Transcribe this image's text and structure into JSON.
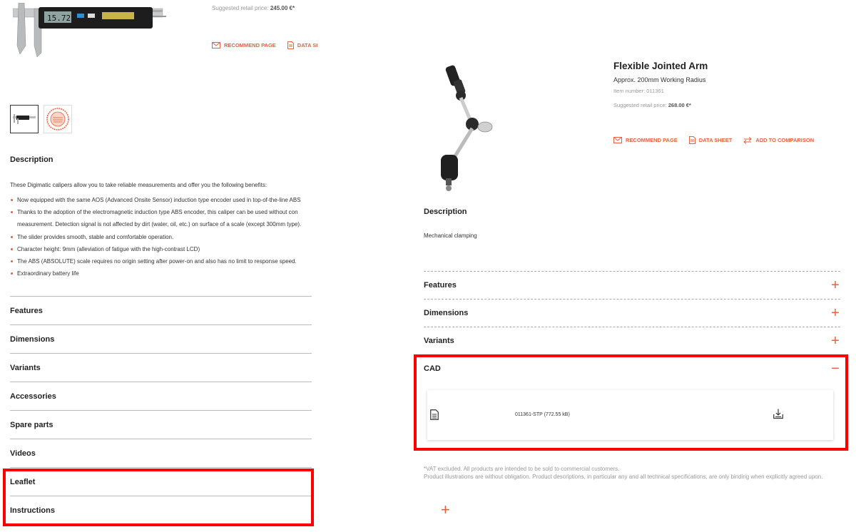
{
  "left": {
    "price_label": "Suggested retail price:",
    "price_value": "245.00 €*",
    "actions": {
      "recommend": "RECOMMEND PAGE",
      "datasheet": "DATA SI"
    },
    "caliper_display": "15.72",
    "description_title": "Description",
    "description_intro": "These Digimatic calipers allow you to take reliable measurements and offer you the following benefits:",
    "bullets": [
      "Now equipped with the same AOS (Advanced Onsite Sensor) induction type encoder used in top-of-the-line ABS",
      "Thanks to the adoption of the electromagnetic induction type ABS encoder, this caliper can be used without con",
      "measurement. Detection signal is not affected by dirt (water, oil, etc.) on surface of a scale (except 300mm type).",
      "The slider provides smooth, stable and comfortable operation.",
      "Character height: 9mm (alleviation of fatigue with the high-contrast LCD)",
      "The ABS (ABSOLUTE) scale requires no origin setting after power-on and also has no limit to response speed.",
      "Extraordinary battery life"
    ],
    "accordion": [
      "Features",
      "Dimensions",
      "Variants",
      "Accessories",
      "Spare parts",
      "Videos",
      "Leaflet",
      "Instructions"
    ]
  },
  "right": {
    "title": "Flexible Jointed Arm",
    "subtitle": "Approx. 200mm Working Radius",
    "item_number": "Item number: 011361",
    "price_label": "Suggested retail price:",
    "price_value": "268.00 €*",
    "actions": {
      "recommend": "RECOMMEND PAGE",
      "datasheet": "DATA SHEET",
      "compare": "ADD TO COMPARISON"
    },
    "description_title": "Description",
    "description_text": "Mechanical clamping",
    "accordion": [
      {
        "label": "Features",
        "toggle": "+"
      },
      {
        "label": "Dimensions",
        "toggle": "+"
      },
      {
        "label": "Variants",
        "toggle": "+"
      },
      {
        "label": "CAD",
        "toggle": "−"
      }
    ],
    "cad_file": "011361-STP (772.55 kB)",
    "vat_line1": "*VAT excluded. All products are intended to be sold to commercial customers.",
    "vat_line2": "Product illustrations are without obligation. Product descriptions, in particular any and all technical specifications, are only binding when explicitly agreed upon.",
    "bottom_toggle": "+"
  },
  "colors": {
    "accent": "#e8603c",
    "highlight": "#ff0000"
  }
}
